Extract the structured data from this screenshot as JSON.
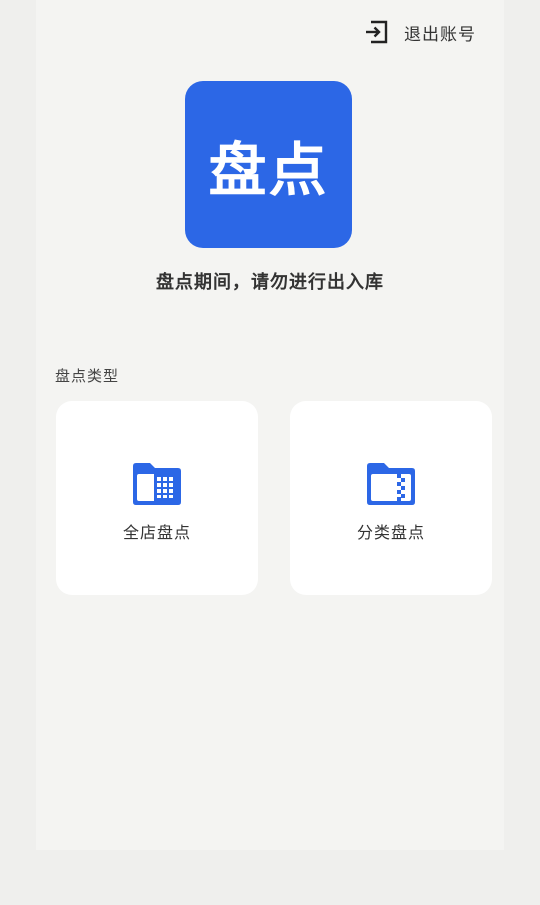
{
  "header": {
    "logout_label": "退出账号"
  },
  "logo": {
    "text": "盘点"
  },
  "notice": "盘点期间，请勿进行出入库",
  "section_title": "盘点类型",
  "cards": [
    {
      "label": "全店盘点",
      "icon": "folder-grid-icon"
    },
    {
      "label": "分类盘点",
      "icon": "folder-zip-icon"
    }
  ],
  "colors": {
    "accent": "#2c67e6",
    "background": "#f4f4f2",
    "card": "#ffffff",
    "text": "#333333"
  }
}
